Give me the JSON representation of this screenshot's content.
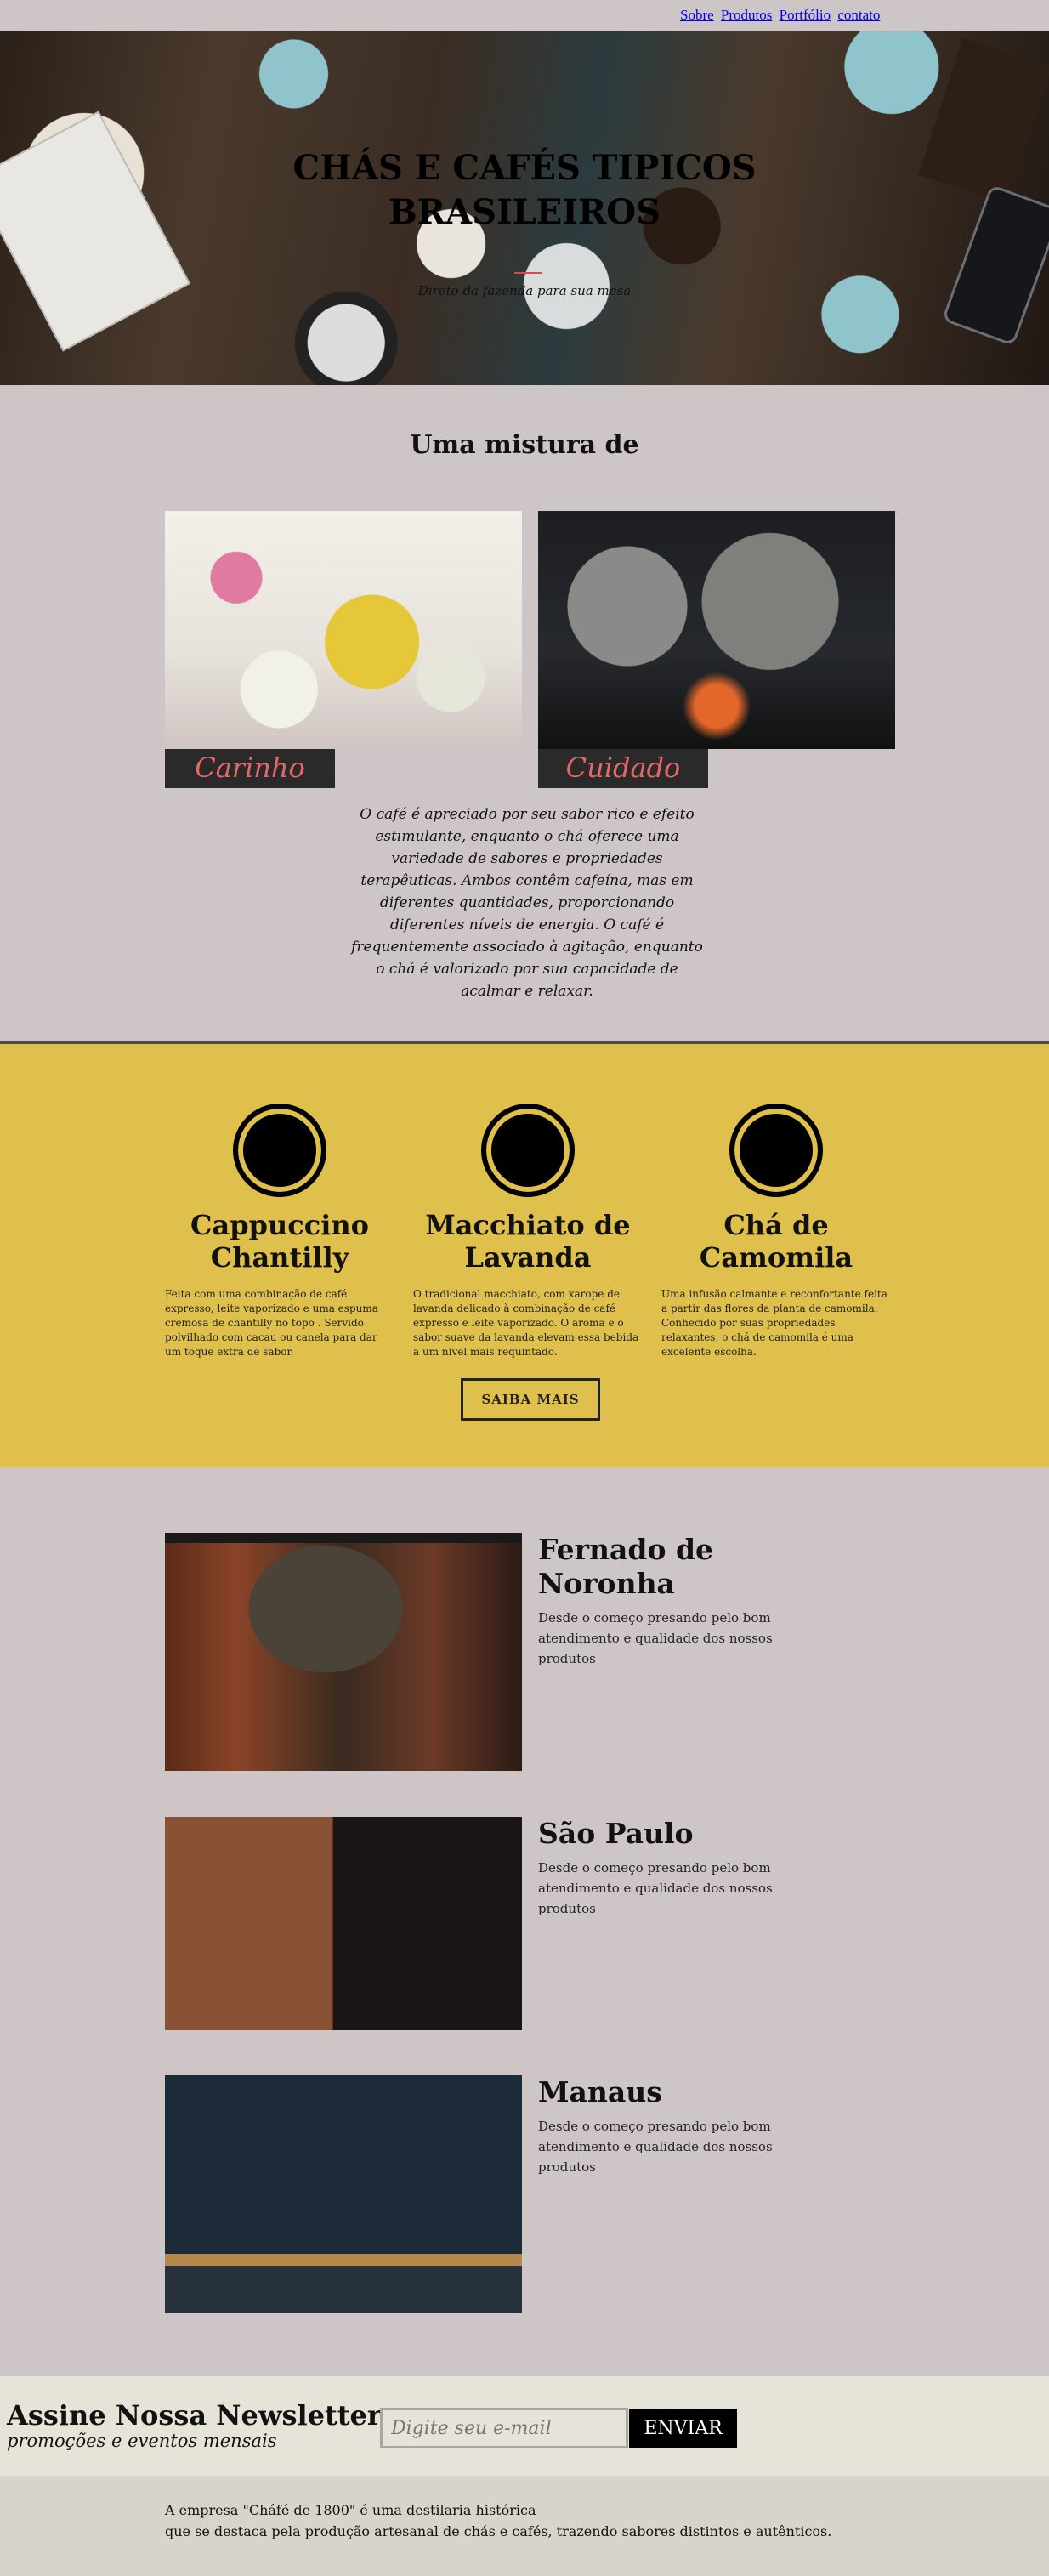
{
  "nav": {
    "links": [
      "Sobre",
      "Produtos",
      "Portfólio",
      "contato"
    ]
  },
  "hero": {
    "title_line1": "CHÁS E CAFÉS TIPICOS",
    "title_line2": "BRASILEIROS",
    "subtitle": "Direto da fazenda para sua mesa",
    "accent_color": "#d64b4b"
  },
  "mix": {
    "title": "Uma mistura de",
    "cards": [
      {
        "label": "Carinho"
      },
      {
        "label": "Cuidado"
      }
    ],
    "text": "O café é apreciado por seu sabor rico e efeito estimulante, enquanto o chá oferece uma variedade de sabores e propriedades terapêuticas. Ambos contêm cafeína, mas em diferentes quantidades, proporcionando diferentes níveis de energia. O café é frequentemente associado à agitação, enquanto o chá é valorizado por sua capacidade de acalmar e relaxar."
  },
  "features": {
    "items": [
      {
        "title": "Cappuccino Chantilly",
        "text": "Feita com uma combinação de café expresso, leite vaporizado e uma espuma cremosa de chantilly no topo . Servido polvilhado com cacau ou canela para dar um toque extra de sabor."
      },
      {
        "title": "Macchiato de Lavanda",
        "text": "O tradicional macchiato, com xarope de lavanda delicado à combinação de café expresso e leite vaporizado. O aroma e o sabor suave da lavanda elevam essa bebida a um nível mais requintado."
      },
      {
        "title": "Chá de Camomila",
        "text": "Uma infusão calmante e reconfortante feita a partir das flores da planta de camomila. Conhecido por suas propriedades relaxantes, o chá de camomila é uma excelente escolha."
      }
    ],
    "button": "SAIBA MAIS",
    "band_color": "#dfc04c"
  },
  "locations": {
    "items": [
      {
        "city": "Fernado de Noronha",
        "text": "Desde o começo presando pelo bom atendimento e qualidade dos nossos produtos"
      },
      {
        "city": "São Paulo",
        "text": "Desde o começo presando pelo bom atendimento e qualidade dos nossos produtos"
      },
      {
        "city": "Manaus",
        "text": "Desde o começo presando pelo bom atendimento e qualidade dos nossos produtos"
      }
    ]
  },
  "newsletter": {
    "title": "Assine Nossa Newsletter",
    "subtitle": "promoções e eventos mensais",
    "placeholder": "Digite seu e-mail",
    "button": "ENVIAR"
  },
  "footer": {
    "line1": "A empresa \"Cháfé de 1800\" é uma destilaria histórica",
    "line2": "que se destaca pela produção artesanal de chás e cafés, trazendo sabores distintos e autênticos."
  }
}
